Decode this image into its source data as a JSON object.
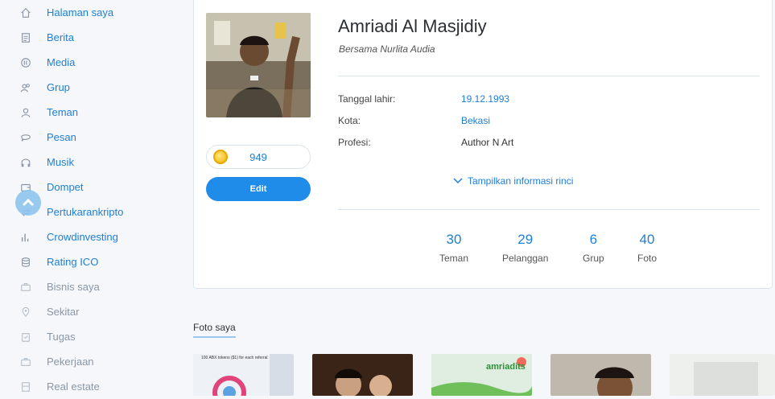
{
  "sidebar": {
    "items": [
      {
        "label": "Halaman saya",
        "icon": "home-icon"
      },
      {
        "label": "Berita",
        "icon": "news-icon"
      },
      {
        "label": "Media",
        "icon": "media-icon"
      },
      {
        "label": "Grup",
        "icon": "group-icon"
      },
      {
        "label": "Teman",
        "icon": "friend-icon"
      },
      {
        "label": "Pesan",
        "icon": "message-icon"
      },
      {
        "label": "Musik",
        "icon": "headphones-icon"
      },
      {
        "label": "Dompet",
        "icon": "wallet-icon"
      },
      {
        "label": "Pertukarankripto",
        "icon": "exchange-icon"
      },
      {
        "label": "Crowdinvesting",
        "icon": "bar-chart-icon"
      },
      {
        "label": "Rating ICO",
        "icon": "database-icon"
      },
      {
        "label": "Bisnis saya",
        "icon": "briefcase-icon"
      },
      {
        "label": "Sekitar",
        "icon": "location-icon"
      },
      {
        "label": "Tugas",
        "icon": "clipboard-icon"
      },
      {
        "label": "Pekerjaan",
        "icon": "briefcase-icon"
      },
      {
        "label": "Real estate",
        "icon": "building-icon"
      }
    ]
  },
  "profile": {
    "name": "Amriadi Al Masjidiy",
    "partner": "Bersama Nurlita Audia",
    "coins": "949",
    "edit_label": "Edit",
    "info": [
      {
        "key": "Tanggal lahir:",
        "value": "19.12.1993"
      },
      {
        "key": "Kota:",
        "value": "Bekasi"
      },
      {
        "key": "Profesi:",
        "value": "Author N Art"
      }
    ],
    "more_label": "Tampilkan informasi rinci",
    "stats": [
      {
        "num": "30",
        "label": "Teman"
      },
      {
        "num": "29",
        "label": "Pelanggan"
      },
      {
        "num": "6",
        "label": "Grup"
      },
      {
        "num": "40",
        "label": "Foto"
      }
    ]
  },
  "photos": {
    "title": "Foto saya",
    "thumb1_caption": "100 ABX tokens ($1) for each referral",
    "thumb3_brand": "amriadits"
  },
  "colors": {
    "accent": "#1e7fd6",
    "button": "#1e8ce8",
    "muted": "#8a97a6"
  }
}
